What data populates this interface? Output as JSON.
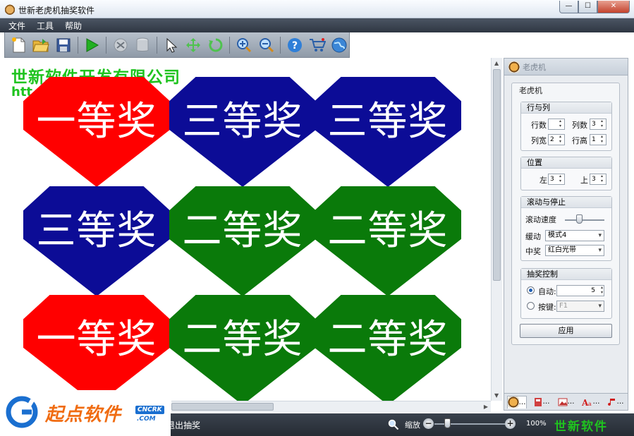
{
  "window": {
    "title": "世新老虎机抽奖软件",
    "controls": [
      "0",
      "1",
      "r"
    ]
  },
  "menu": [
    {
      "label": "文件"
    },
    {
      "label": "工具"
    },
    {
      "label": "帮助"
    }
  ],
  "toolbar": {
    "icons": [
      "new-file-icon",
      "open-folder-icon",
      "save-icon",
      "play-icon",
      "settings-icon",
      "database-icon",
      "pointer-icon",
      "move-icon",
      "refresh-icon",
      "zoom-in-icon",
      "zoom-out-icon",
      "help-icon",
      "cart-icon",
      "globe-icon"
    ]
  },
  "canvas": {
    "company_name": "世新软件开发有限公司",
    "company_url": "htt",
    "tiles": [
      {
        "label": "一等奖",
        "color": "#ff0000"
      },
      {
        "label": "三等奖",
        "color": "#0c0c96"
      },
      {
        "label": "三等奖",
        "color": "#0c0c96"
      },
      {
        "label": "三等奖",
        "color": "#0c0c96"
      },
      {
        "label": "二等奖",
        "color": "#0a7a0a"
      },
      {
        "label": "二等奖",
        "color": "#0a7a0a"
      },
      {
        "label": "一等奖",
        "color": "#ff0000"
      },
      {
        "label": "二等奖",
        "color": "#0a7a0a"
      },
      {
        "label": "二等奖",
        "color": "#0a7a0a"
      }
    ]
  },
  "panel": {
    "header": "老虎机",
    "group": "老虎机",
    "rows_cols": {
      "title": "行与列",
      "cols_label": "行数",
      "cols_value": "",
      "rows_label": "列数",
      "rows_value": "3",
      "col_width_label": "列宽",
      "col_width_value": "2",
      "row_height_label": "行高",
      "row_height_value": "1"
    },
    "position": {
      "title": "位置",
      "left_label": "左",
      "left_value": "3",
      "top_label": "上",
      "top_value": "3"
    },
    "scroll": {
      "title": "滚动与停止",
      "speed_label": "滚动速度",
      "speed_value": 0.35,
      "ease_label": "缓动",
      "ease_value": "模式4",
      "win_label": "中奖",
      "win_value": "红白光带"
    },
    "draw": {
      "title": "抽奖控制",
      "auto_label": "自动:",
      "auto_value": "5",
      "key_label": "按键:",
      "key_value": "F1"
    },
    "apply_label": "应用",
    "tabs": [
      "tiger-icon",
      "book-icon",
      "image-icon",
      "text-icon",
      "music-icon"
    ]
  },
  "status": {
    "text": "退出抽奖",
    "zoom_label": "缩放",
    "zoom_value": "100%",
    "brand": "世新软件"
  },
  "watermark": {
    "text": "起点软件",
    "badge": "CNCRK",
    "domain": ".COM"
  },
  "colors": {
    "brand_green": "#1fc31f",
    "prize_red": "#ff0000",
    "prize_blue": "#0c0c96",
    "prize_green": "#0a7a0a"
  }
}
